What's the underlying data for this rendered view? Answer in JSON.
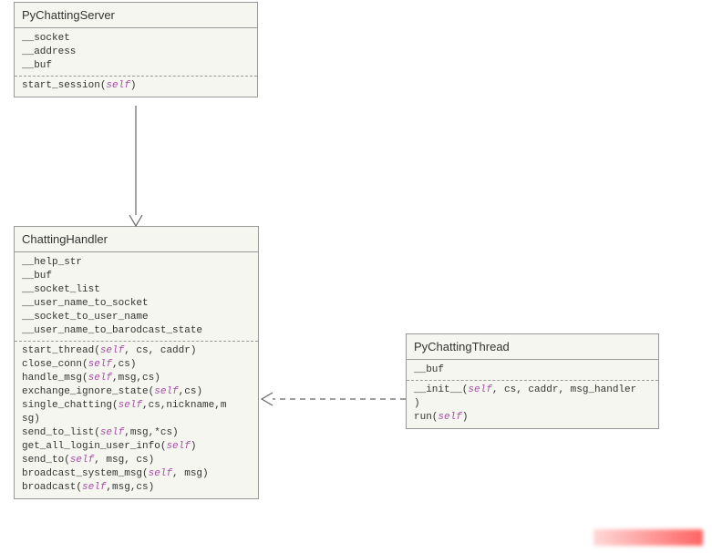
{
  "classes": {
    "server": {
      "name": "PyChattingServer",
      "attrs": [
        "__socket",
        "__address",
        "__buf"
      ],
      "methods": [
        [
          {
            "t": "start_session("
          },
          {
            "t": "self",
            "s": 1
          },
          {
            "t": ")"
          }
        ]
      ]
    },
    "handler": {
      "name": "ChattingHandler",
      "attrs": [
        "__help_str",
        "__buf",
        "__socket_list",
        "__user_name_to_socket",
        "__socket_to_user_name",
        "__user_name_to_barodcast_state"
      ],
      "methods": [
        [
          {
            "t": "start_thread("
          },
          {
            "t": "self",
            "s": 1
          },
          {
            "t": ", cs, caddr)"
          }
        ],
        [
          {
            "t": "close_conn("
          },
          {
            "t": "self",
            "s": 1
          },
          {
            "t": ",cs)"
          }
        ],
        [
          {
            "t": "handle_msg("
          },
          {
            "t": "self",
            "s": 1
          },
          {
            "t": ",msg,cs)"
          }
        ],
        [
          {
            "t": "exchange_ignore_state("
          },
          {
            "t": "self",
            "s": 1
          },
          {
            "t": ",cs)"
          }
        ],
        [
          {
            "t": "single_chatting("
          },
          {
            "t": "self",
            "s": 1
          },
          {
            "t": ",cs,nickname,m"
          }
        ],
        [
          {
            "t": "sg)"
          }
        ],
        [
          {
            "t": "send_to_list("
          },
          {
            "t": "self",
            "s": 1
          },
          {
            "t": ",msg,*cs)"
          }
        ],
        [
          {
            "t": "get_all_login_user_info("
          },
          {
            "t": "self",
            "s": 1
          },
          {
            "t": ")"
          }
        ],
        [
          {
            "t": "send_to("
          },
          {
            "t": "self",
            "s": 1
          },
          {
            "t": ", msg, cs)"
          }
        ],
        [
          {
            "t": "broadcast_system_msg("
          },
          {
            "t": "self",
            "s": 1
          },
          {
            "t": ", msg)"
          }
        ],
        [
          {
            "t": "broadcast("
          },
          {
            "t": "self",
            "s": 1
          },
          {
            "t": ",msg,cs)"
          }
        ]
      ]
    },
    "thread": {
      "name": "PyChattingThread",
      "attrs": [
        "__buf"
      ],
      "methods": [
        [
          {
            "t": "__init__("
          },
          {
            "t": "self",
            "s": 1
          },
          {
            "t": ", cs, caddr, msg_handler"
          }
        ],
        [
          {
            "t": ")"
          }
        ],
        [
          {
            "t": "run("
          },
          {
            "t": "self",
            "s": 1
          },
          {
            "t": ")"
          }
        ]
      ]
    }
  },
  "chart_data": {
    "type": "uml-class-diagram",
    "classes": [
      {
        "name": "PyChattingServer",
        "attributes": [
          "__socket",
          "__address",
          "__buf"
        ],
        "methods": [
          "start_session(self)"
        ]
      },
      {
        "name": "ChattingHandler",
        "attributes": [
          "__help_str",
          "__buf",
          "__socket_list",
          "__user_name_to_socket",
          "__socket_to_user_name",
          "__user_name_to_barodcast_state"
        ],
        "methods": [
          "start_thread(self, cs, caddr)",
          "close_conn(self,cs)",
          "handle_msg(self,msg,cs)",
          "exchange_ignore_state(self,cs)",
          "single_chatting(self,cs,nickname,msg)",
          "send_to_list(self,msg,*cs)",
          "get_all_login_user_info(self)",
          "send_to(self, msg, cs)",
          "broadcast_system_msg(self, msg)",
          "broadcast(self,msg,cs)"
        ]
      },
      {
        "name": "PyChattingThread",
        "attributes": [
          "__buf"
        ],
        "methods": [
          "__init__(self, cs, caddr, msg_handler)",
          "run(self)"
        ]
      }
    ],
    "relationships": [
      {
        "from": "PyChattingServer",
        "to": "ChattingHandler",
        "type": "association",
        "line": "solid",
        "arrow": "open"
      },
      {
        "from": "PyChattingThread",
        "to": "ChattingHandler",
        "type": "dependency",
        "line": "dashed",
        "arrow": "open"
      }
    ]
  }
}
